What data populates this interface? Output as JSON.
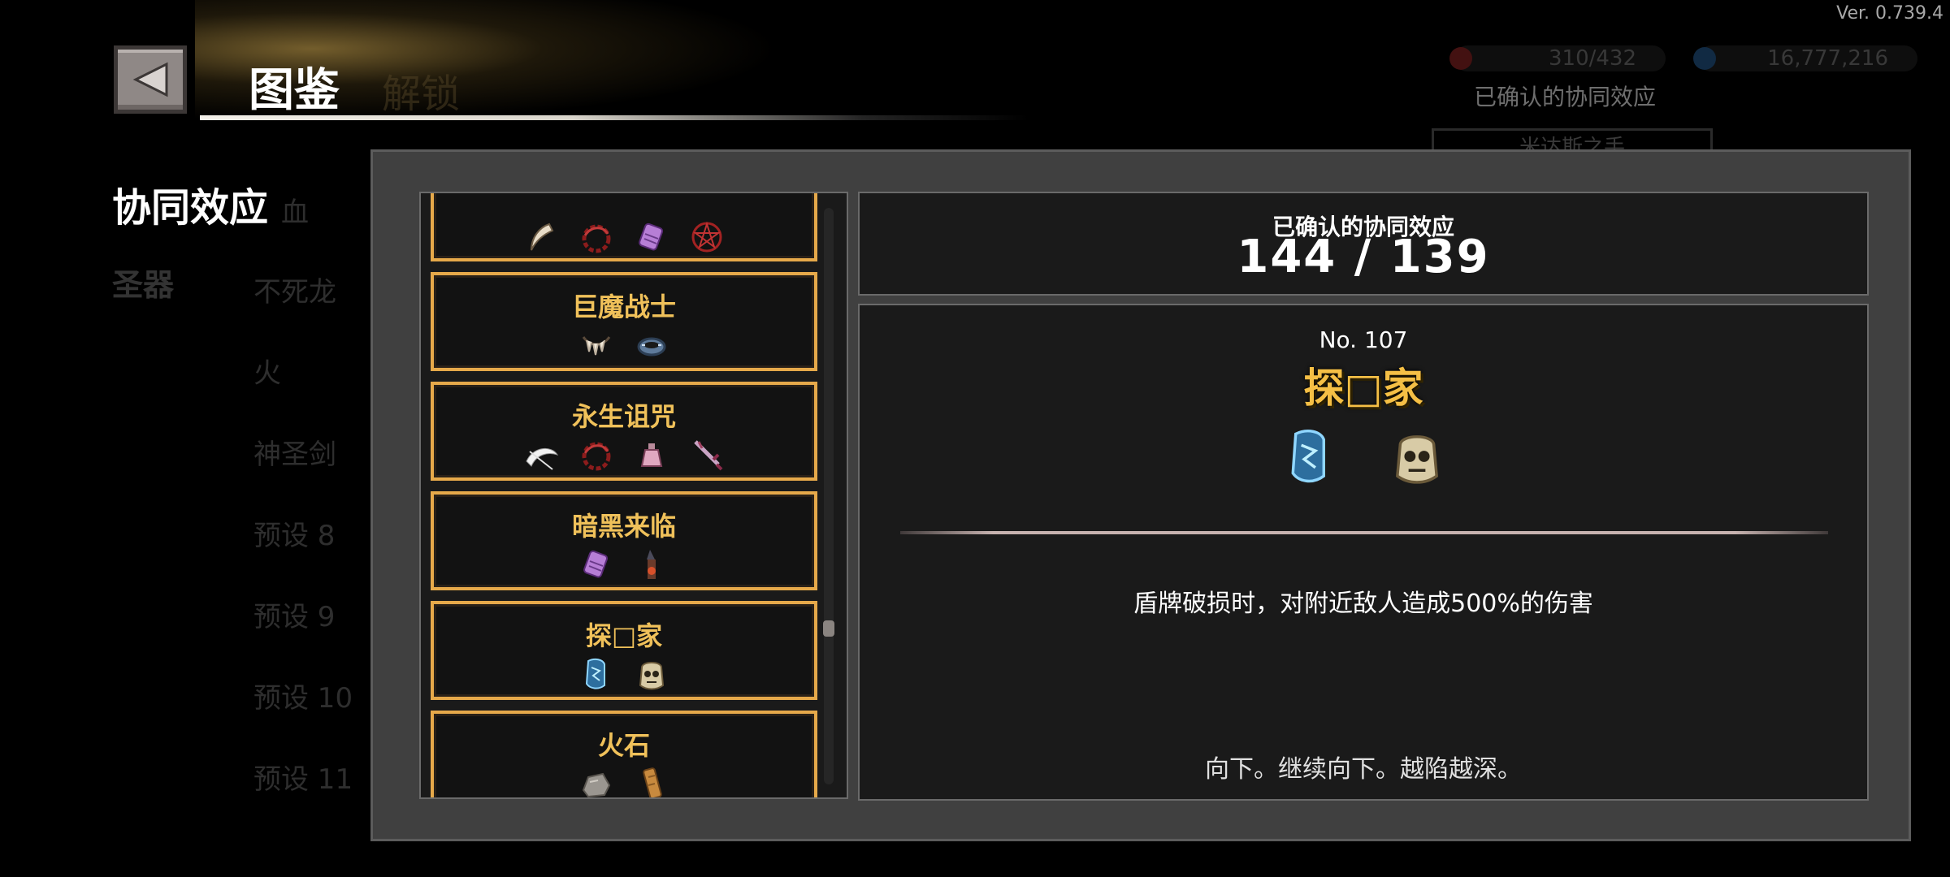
{
  "version": "Ver. 0.739.4",
  "header": {
    "title": "图鉴",
    "faded_tab": "解锁",
    "back_icon": "back-arrow-icon"
  },
  "background": {
    "resource_1": "310/432",
    "resource_2": "16,777,216",
    "confirmed_label": "已确认的协同效应",
    "card_title": "米达斯之手"
  },
  "sidebar": {
    "title": "协同效应",
    "sub": "圣器",
    "faded_items": [
      "血",
      "不死龙",
      "火",
      "神圣剑",
      "预设 8",
      "预设 9",
      "预设 10",
      "预设 11"
    ]
  },
  "synergy_list": [
    {
      "name": "",
      "icons": [
        "claw-icon",
        "red-swirl-icon",
        "purple-scroll-icon",
        "pentagram-icon"
      ]
    },
    {
      "name": "巨魔战士",
      "icons": [
        "tooth-necklace-icon",
        "steel-ring-icon"
      ]
    },
    {
      "name": "永生诅咒",
      "icons": [
        "scythe-icon",
        "red-swirl-icon",
        "potion-icon",
        "cursed-sword-icon"
      ]
    },
    {
      "name": "暗黑来临",
      "icons": [
        "purple-scroll-icon",
        "dark-torch-icon"
      ]
    },
    {
      "name": "探□家",
      "icons": [
        "blue-scroll-icon",
        "skull-bag-icon"
      ]
    },
    {
      "name": "火石",
      "icons": [
        "flint-stone-icon",
        "wooden-stick-icon"
      ]
    }
  ],
  "summary": {
    "label": "已确认的协同效应",
    "value": "144 / 139"
  },
  "detail": {
    "number": "No. 107",
    "name": "探□家",
    "icons": [
      "blue-scroll-icon",
      "skull-bag-icon"
    ],
    "effect": "盾牌破损时，对附近敌人造成500%的伤害",
    "flavor": "向下。继续向下。越陷越深。"
  },
  "colors": {
    "accent_gold": "#f0c15a",
    "entry_border": "#e6a94a",
    "panel_bg": "#404040"
  }
}
